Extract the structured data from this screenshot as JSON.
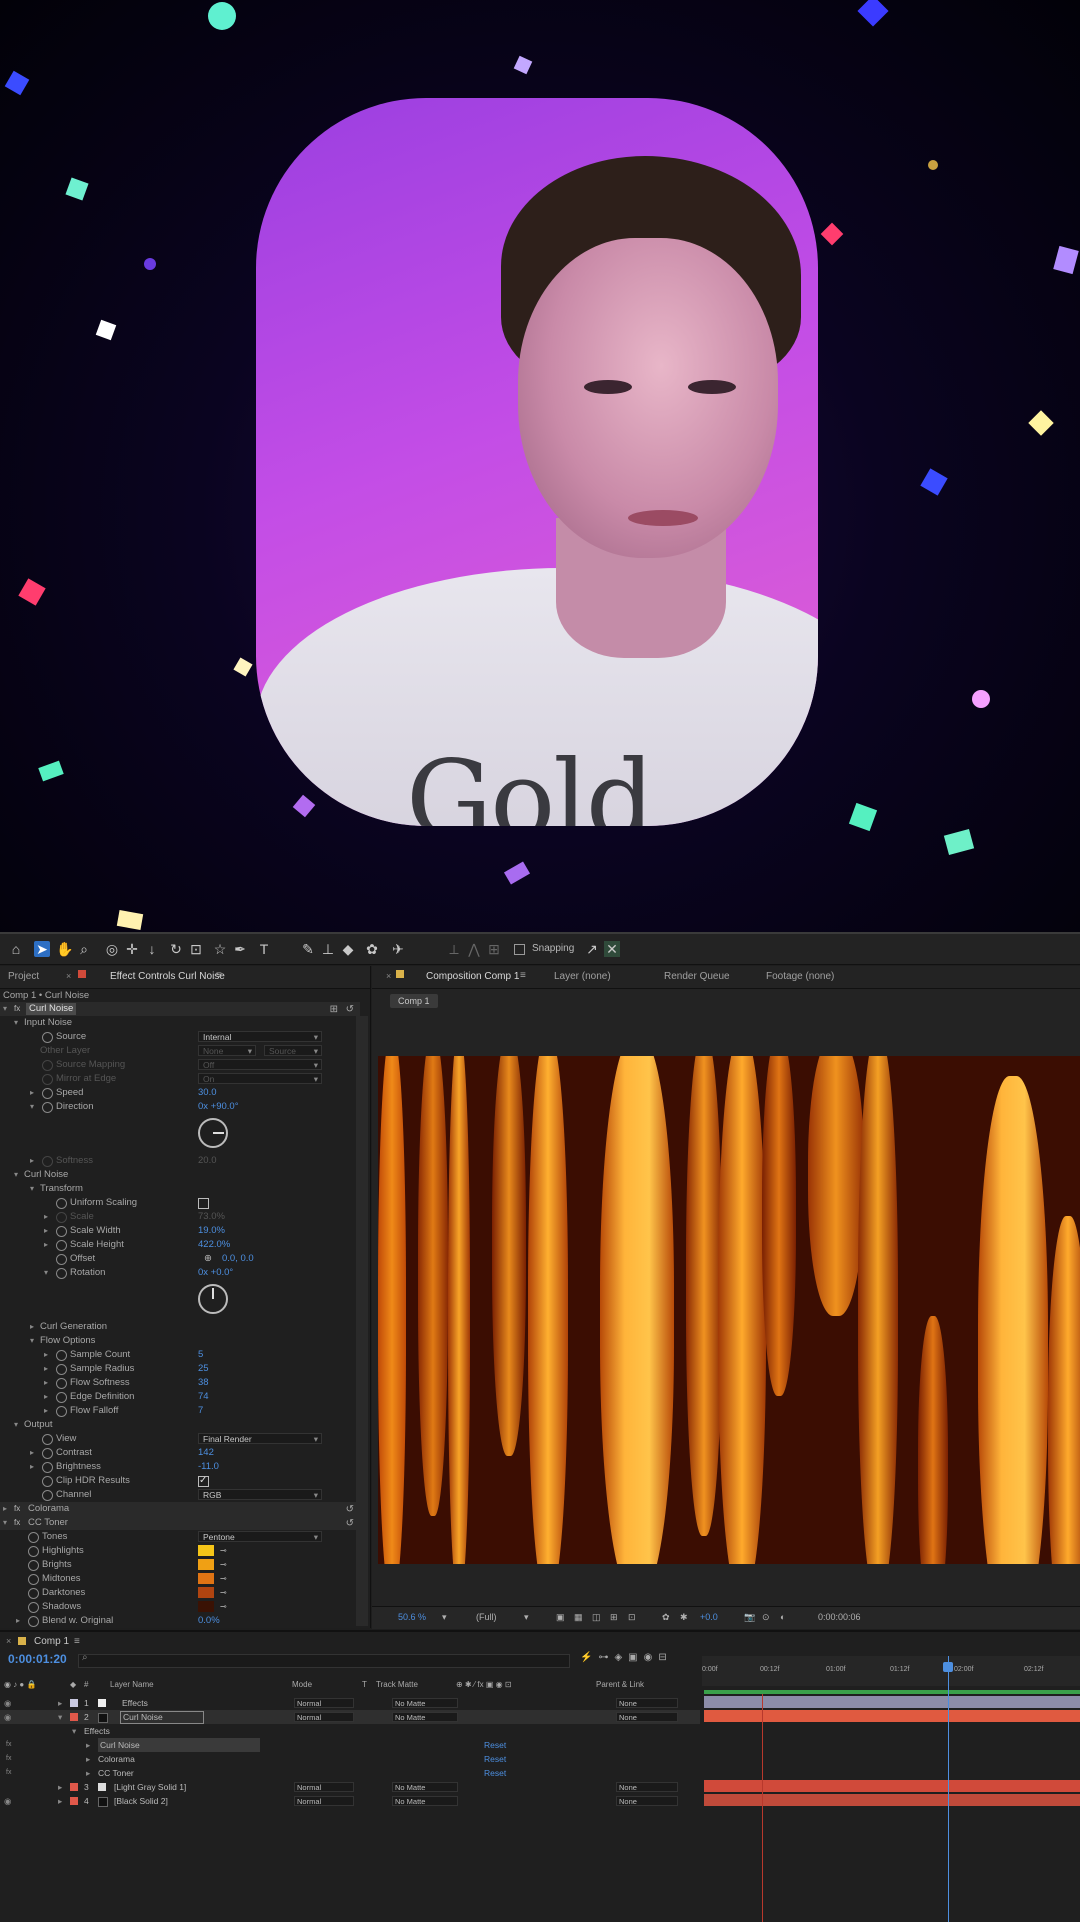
{
  "video": {
    "shirt_text": "Gold"
  },
  "toolbar": {
    "snapping_label": "Snapping"
  },
  "effect_controls": {
    "tab_project": "Project",
    "tab_effect_controls": "Effect Controls Curl Noise",
    "subheader": "Comp 1 • Curl Noise",
    "effect_name": "Curl Noise",
    "input_noise": "Input Noise",
    "source_label": "Source",
    "source_value": "Internal",
    "other_layer_label": "Other Layer",
    "other_layer_value": "None",
    "other_layer_value2": "Source",
    "source_mapping_label": "Source Mapping",
    "source_mapping_value": "Off",
    "mirror_label": "Mirror at Edge",
    "mirror_value": "On",
    "speed_label": "Speed",
    "speed_value": "30.0",
    "direction_label": "Direction",
    "direction_value": "0x +90.0°",
    "softness_label": "Softness",
    "softness_value": "20.0",
    "curl_noise_group": "Curl Noise",
    "transform_group": "Transform",
    "uniform_scaling_label": "Uniform Scaling",
    "scale_label": "Scale",
    "scale_value": "73.0%",
    "scale_width_label": "Scale Width",
    "scale_width_value": "19.0%",
    "scale_height_label": "Scale Height",
    "scale_height_value": "422.0%",
    "offset_label": "Offset",
    "offset_value": "0.0, 0.0",
    "rotation_label": "Rotation",
    "rotation_value": "0x +0.0°",
    "curl_generation": "Curl Generation",
    "flow_options": "Flow Options",
    "sample_count_label": "Sample Count",
    "sample_count_value": "5",
    "sample_radius_label": "Sample Radius",
    "sample_radius_value": "25",
    "flow_softness_label": "Flow Softness",
    "flow_softness_value": "38",
    "edge_definition_label": "Edge Definition",
    "edge_definition_value": "74",
    "flow_falloff_label": "Flow Falloff",
    "flow_falloff_value": "7",
    "output_group": "Output",
    "view_label": "View",
    "view_value": "Final Render",
    "contrast_label": "Contrast",
    "contrast_value": "142",
    "brightness_label": "Brightness",
    "brightness_value": "-11.0",
    "clip_hdr_label": "Clip HDR Results",
    "channel_label": "Channel",
    "channel_value": "RGB",
    "colorama_label": "Colorama",
    "cc_toner_label": "CC Toner",
    "tones_label": "Tones",
    "tones_value": "Pentone",
    "highlights_label": "Highlights",
    "brights_label": "Brights",
    "midtones_label": "Midtones",
    "darktones_label": "Darktones",
    "shadows_label": "Shadows",
    "blend_label": "Blend w. Original",
    "blend_value": "0.0%",
    "colors": {
      "highlights": "#f5c518",
      "brights": "#f0a014",
      "midtones": "#e07414",
      "darktones": "#b04410",
      "shadows": "#3a1204"
    }
  },
  "composition": {
    "tab_composition": "Composition Comp 1",
    "tab_layer": "Layer (none)",
    "tab_render_queue": "Render Queue",
    "tab_footage": "Footage (none)",
    "breadcrumb": "Comp 1",
    "zoom": "50.6 %",
    "quality": "(Full)",
    "exposure": "+0.0",
    "timecode": "0:00:00:06"
  },
  "timeline": {
    "tab": "Comp 1",
    "current_time": "0:00:01:20",
    "col_layer_name": "Layer Name",
    "col_mode": "Mode",
    "col_t": "T",
    "col_track_matte": "Track Matte",
    "col_parent": "Parent & Link",
    "ruler": [
      "0:00f",
      "00:12f",
      "01:00f",
      "01:12f",
      "02:00f",
      "02:12f"
    ],
    "layers": [
      {
        "num": "1",
        "name": "Effects",
        "mode": "Normal",
        "matte": "No Matte",
        "parent": "None",
        "color": "#c9c9e0"
      },
      {
        "num": "2",
        "name": "Curl Noise",
        "mode": "Normal",
        "matte": "No Matte",
        "parent": "None",
        "color": "#e0584a"
      },
      {
        "num": "3",
        "name": "[Light Gray Solid 1]",
        "mode": "Normal",
        "matte": "No Matte",
        "parent": "None",
        "color": "#e0584a"
      },
      {
        "num": "4",
        "name": "[Black Solid 2]",
        "mode": "Normal",
        "matte": "No Matte",
        "parent": "None",
        "color": "#e0584a"
      }
    ],
    "effects_group": "Effects",
    "fx_curl_noise": "Curl Noise",
    "fx_colorama": "Colorama",
    "fx_cc_toner": "CC Toner",
    "reset_label": "Reset"
  }
}
